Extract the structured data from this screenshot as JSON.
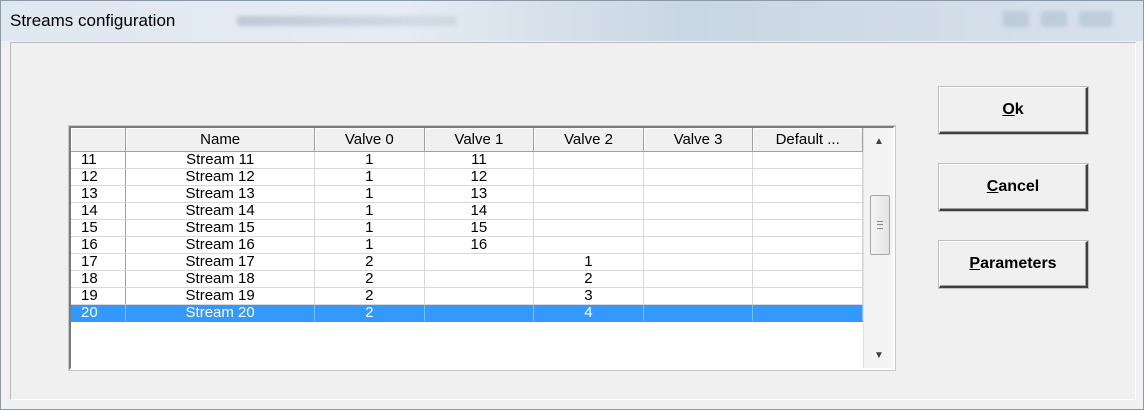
{
  "window": {
    "title": "Streams configuration"
  },
  "grid": {
    "headers": [
      "",
      "Name",
      "Valve 0",
      "Valve 1",
      "Valve 2",
      "Valve 3",
      "Default ..."
    ],
    "rows": [
      {
        "num": "11",
        "name": "Stream 11",
        "v0": "1",
        "v1": "11",
        "v2": "",
        "v3": "",
        "def": ""
      },
      {
        "num": "12",
        "name": "Stream 12",
        "v0": "1",
        "v1": "12",
        "v2": "",
        "v3": "",
        "def": ""
      },
      {
        "num": "13",
        "name": "Stream 13",
        "v0": "1",
        "v1": "13",
        "v2": "",
        "v3": "",
        "def": ""
      },
      {
        "num": "14",
        "name": "Stream 14",
        "v0": "1",
        "v1": "14",
        "v2": "",
        "v3": "",
        "def": ""
      },
      {
        "num": "15",
        "name": "Stream 15",
        "v0": "1",
        "v1": "15",
        "v2": "",
        "v3": "",
        "def": ""
      },
      {
        "num": "16",
        "name": "Stream 16",
        "v0": "1",
        "v1": "16",
        "v2": "",
        "v3": "",
        "def": ""
      },
      {
        "num": "17",
        "name": "Stream 17",
        "v0": "2",
        "v1": "",
        "v2": "1",
        "v3": "",
        "def": ""
      },
      {
        "num": "18",
        "name": "Stream 18",
        "v0": "2",
        "v1": "",
        "v2": "2",
        "v3": "",
        "def": ""
      },
      {
        "num": "19",
        "name": "Stream 19",
        "v0": "2",
        "v1": "",
        "v2": "3",
        "v3": "",
        "def": ""
      },
      {
        "num": "20",
        "name": "Stream 20",
        "v0": "2",
        "v1": "",
        "v2": "4",
        "v3": "",
        "def": ""
      }
    ],
    "selected_row": "20"
  },
  "buttons": {
    "ok": {
      "mnemonic": "O",
      "rest": "k"
    },
    "cancel": {
      "mnemonic": "C",
      "rest": "ancel"
    },
    "parameters": {
      "mnemonic": "P",
      "rest": "arameters"
    }
  },
  "colors": {
    "selection": "#3399ff",
    "face": "#f0f0f0"
  },
  "icons": {
    "scroll_up": "scroll-up-arrow-icon",
    "scroll_down": "scroll-down-arrow-icon",
    "thumb_grip": "grip-icon"
  }
}
